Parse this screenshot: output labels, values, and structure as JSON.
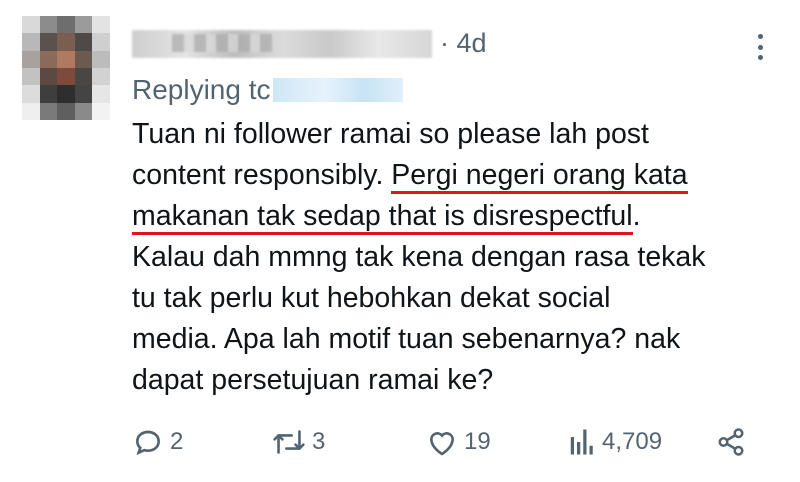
{
  "tweet": {
    "time": "· 4d",
    "replying_to_label": "Replying tc",
    "text": {
      "l1": "Tuan ni follower ramai so please lah post",
      "l2a": "content responsibly. ",
      "l2b": "Pergi negeri orang kata",
      "l3": "makanan tak sedap that is disrespectful",
      "l3end": ".",
      "l4": "Kalau dah mmng tak kena dengan rasa tekak",
      "l5": "tu tak perlu kut hebohkan dekat social",
      "l6": "media. Apa lah motif tuan sebenarnya? nak",
      "l7": "dapat persetujuan ramai ke?"
    },
    "actions": {
      "replies": "2",
      "reposts": "3",
      "likes": "19",
      "views": "4,709"
    },
    "colors": {
      "text": "#0f1419",
      "muted": "#536471",
      "highlight_underline": "#e3131b"
    }
  }
}
